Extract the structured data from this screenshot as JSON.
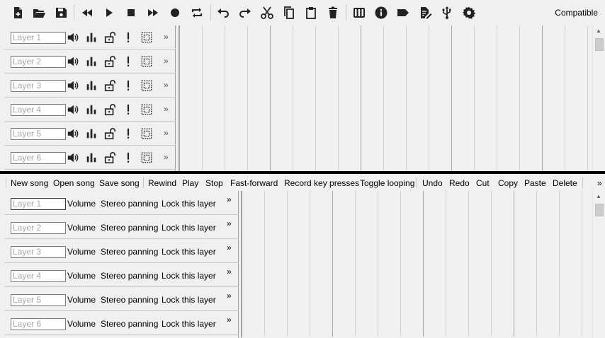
{
  "toolbar": {
    "icons": [
      "new-song-icon",
      "open-song-icon",
      "save-song-icon",
      "rewind-icon",
      "play-icon",
      "stop-icon",
      "fast-forward-icon",
      "record-icon",
      "loop-icon",
      "undo-icon",
      "redo-icon",
      "cut-icon",
      "copy-icon",
      "paste-icon",
      "delete-icon",
      "instruments-icon",
      "info-icon",
      "tag-icon",
      "edit-document-icon",
      "usb-icon",
      "settings-icon"
    ],
    "status": "Compatible"
  },
  "layers": [
    {
      "name": "Layer 1"
    },
    {
      "name": "Layer 2"
    },
    {
      "name": "Layer 3"
    },
    {
      "name": "Layer 4"
    },
    {
      "name": "Layer 5"
    },
    {
      "name": "Layer 6"
    }
  ],
  "text_toolbar": {
    "items": [
      "New song",
      "Open song",
      "Save song",
      "Rewind",
      "Play",
      "Stop",
      "Fast-forward",
      "Record key presses",
      "Toggle looping",
      "Undo",
      "Redo",
      "Cut",
      "Copy",
      "Paste",
      "Delete"
    ],
    "overflow": "»"
  },
  "text_layers": {
    "volume_label": "Volume",
    "panning_label": "Stereo panning",
    "lock_label": "Lock this layer",
    "more_label": "»"
  },
  "layer_more": "»"
}
